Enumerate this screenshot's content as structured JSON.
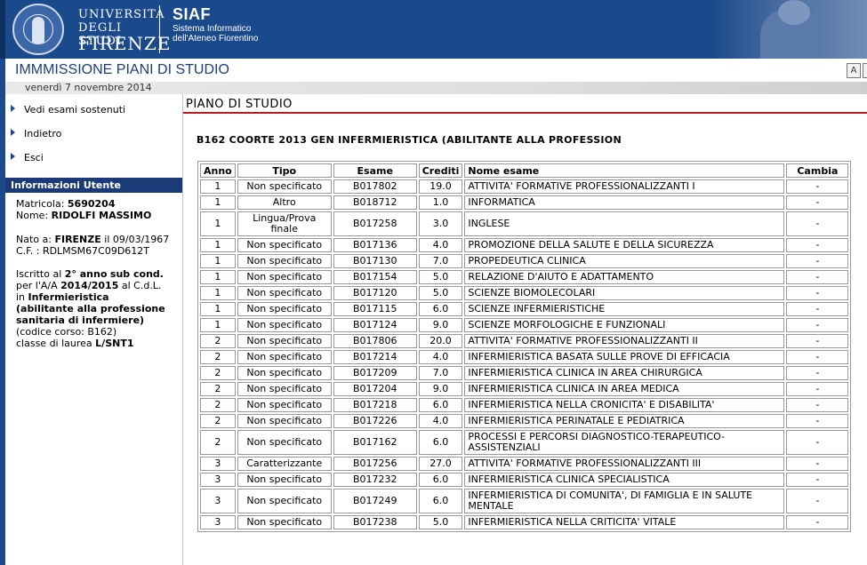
{
  "header": {
    "university": [
      "UNIVERSITÀ",
      "DEGLI STUDI",
      "FIRENZE"
    ],
    "siaf_title": "SIAF",
    "siaf_subtitle": [
      "Sistema Informatico",
      "dell'Ateneo Fiorentino"
    ]
  },
  "page": {
    "title": "IMMMISSIONE PIANI DI STUDIO",
    "date": "venerdì 7 novembre 2014",
    "font_button": "A"
  },
  "nav": {
    "items": [
      {
        "label": "Vedi esami sostenuti"
      },
      {
        "label": "Indietro"
      },
      {
        "label": "Esci"
      }
    ]
  },
  "user_info": {
    "heading": "Informazioni Utente",
    "matricola_label": "Matricola:",
    "matricola": "5690204",
    "nome_label": "Nome:",
    "nome": "RIDOLFI MASSIMO",
    "nato_label": "Nato a:",
    "luogo_nascita": "FIRENZE",
    "il_label": "il",
    "data_nascita": "09/03/1967",
    "cf_label": "C.F. :",
    "cf": "RDLMSM67C09D612T",
    "iscritto_label": "Iscritto al",
    "anno": "2° anno",
    "sub_cond": "sub cond.",
    "aa_label": "per l'A/A",
    "aa": "2014/2015",
    "cdl_label": "al C.d.L.",
    "in_label": "in",
    "corso_nome_1": "Infermieristica",
    "corso_nome_2": "(abilitante alla professione",
    "corso_nome_3": "sanitaria di infermiere)",
    "codice_corso": "(codice corso: B162)",
    "classe_label": "classe di laurea",
    "classe": "L/SNT1"
  },
  "main": {
    "title": "PIANO DI STUDIO",
    "course_line": "B162 COORTE 2013 GEN INFERMIERISTICA (ABILITANTE ALLA PROFESSION",
    "columns": [
      "Anno",
      "Tipo",
      "Esame",
      "Crediti",
      "Nome esame",
      "Cambia"
    ],
    "rows": [
      {
        "anno": "1",
        "tipo": "Non specificato",
        "esame": "B017802",
        "crediti": "19.0",
        "nome": "ATTIVITA' FORMATIVE PROFESSIONALIZZANTI I",
        "cambia": "-"
      },
      {
        "anno": "1",
        "tipo": "Altro",
        "esame": "B018712",
        "crediti": "1.0",
        "nome": "INFORMATICA",
        "cambia": "-"
      },
      {
        "anno": "1",
        "tipo": "Lingua/Prova finale",
        "esame": "B017258",
        "crediti": "3.0",
        "nome": "INGLESE",
        "cambia": "-",
        "tall": true
      },
      {
        "anno": "1",
        "tipo": "Non specificato",
        "esame": "B017136",
        "crediti": "4.0",
        "nome": "PROMOZIONE DELLA SALUTE E DELLA SICUREZZA",
        "cambia": "-"
      },
      {
        "anno": "1",
        "tipo": "Non specificato",
        "esame": "B017130",
        "crediti": "7.0",
        "nome": "PROPEDEUTICA CLINICA",
        "cambia": "-"
      },
      {
        "anno": "1",
        "tipo": "Non specificato",
        "esame": "B017154",
        "crediti": "5.0",
        "nome": "RELAZIONE D'AIUTO E ADATTAMENTO",
        "cambia": "-"
      },
      {
        "anno": "1",
        "tipo": "Non specificato",
        "esame": "B017120",
        "crediti": "5.0",
        "nome": "SCIENZE BIOMOLECOLARI",
        "cambia": "-"
      },
      {
        "anno": "1",
        "tipo": "Non specificato",
        "esame": "B017115",
        "crediti": "6.0",
        "nome": "SCIENZE INFERMIERISTICHE",
        "cambia": "-"
      },
      {
        "anno": "1",
        "tipo": "Non specificato",
        "esame": "B017124",
        "crediti": "9.0",
        "nome": "SCIENZE MORFOLOGICHE E FUNZIONALI",
        "cambia": "-"
      },
      {
        "anno": "2",
        "tipo": "Non specificato",
        "esame": "B017806",
        "crediti": "20.0",
        "nome": "ATTIVITA' FORMATIVE PROFESSIONALIZZANTI II",
        "cambia": "-"
      },
      {
        "anno": "2",
        "tipo": "Non specificato",
        "esame": "B017214",
        "crediti": "4.0",
        "nome": "INFERMIERISTICA BASATA SULLE PROVE DI EFFICACIA",
        "cambia": "-"
      },
      {
        "anno": "2",
        "tipo": "Non specificato",
        "esame": "B017209",
        "crediti": "7.0",
        "nome": "INFERMIERISTICA CLINICA IN AREA CHIRURGICA",
        "cambia": "-"
      },
      {
        "anno": "2",
        "tipo": "Non specificato",
        "esame": "B017204",
        "crediti": "9.0",
        "nome": "INFERMIERISTICA CLINICA IN AREA MEDICA",
        "cambia": "-"
      },
      {
        "anno": "2",
        "tipo": "Non specificato",
        "esame": "B017218",
        "crediti": "6.0",
        "nome": "INFERMIERISTICA NELLA CRONICITA' E DISABILITA'",
        "cambia": "-"
      },
      {
        "anno": "2",
        "tipo": "Non specificato",
        "esame": "B017226",
        "crediti": "4.0",
        "nome": "INFERMIERISTICA PERINATALE E PEDIATRICA",
        "cambia": "-"
      },
      {
        "anno": "2",
        "tipo": "Non specificato",
        "esame": "B017162",
        "crediti": "6.0",
        "nome": "PROCESSI E PERCORSI DIAGNOSTICO-TERAPEUTICO-ASSISTENZIALI",
        "cambia": "-",
        "tall": true
      },
      {
        "anno": "3",
        "tipo": "Caratterizzante",
        "esame": "B017256",
        "crediti": "27.0",
        "nome": "ATTIVITA' FORMATIVE PROFESSIONALIZZANTI III",
        "cambia": "-"
      },
      {
        "anno": "3",
        "tipo": "Non specificato",
        "esame": "B017232",
        "crediti": "6.0",
        "nome": "INFERMIERISTICA CLINICA SPECIALISTICA",
        "cambia": "-"
      },
      {
        "anno": "3",
        "tipo": "Non specificato",
        "esame": "B017249",
        "crediti": "6.0",
        "nome": "INFERMIERISTICA DI COMUNITA', DI FAMIGLIA E IN SALUTE MENTALE",
        "cambia": "-",
        "tall": true
      },
      {
        "anno": "3",
        "tipo": "Non specificato",
        "esame": "B017238",
        "crediti": "5.0",
        "nome": "INFERMIERISTICA NELLA CRITICITA' VITALE",
        "cambia": "-"
      }
    ]
  }
}
